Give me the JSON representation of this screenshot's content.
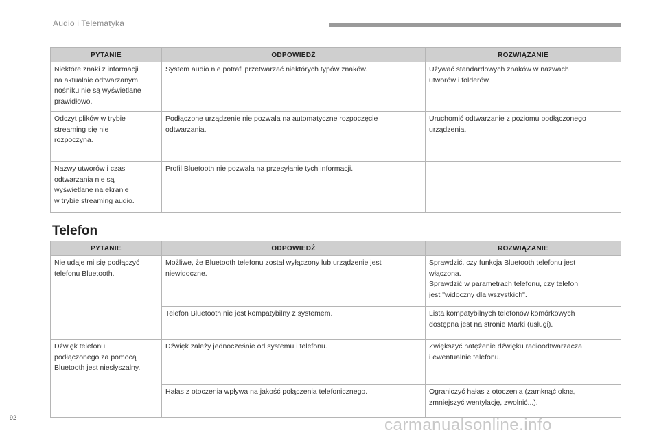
{
  "header": {
    "title": "Audio i Telematyka"
  },
  "table_audio": {
    "headers": [
      "PYTANIE",
      "ODPOWIEDŹ",
      "ROZWIĄZANIE"
    ],
    "rows": [
      {
        "question": "Niektóre znaki z informacji\nna aktualnie odtwarzanym\nnośniku nie są wyświetlane\nprawidłowo.",
        "answer": "System audio nie potrafi przetwarzać niektórych typów znaków.",
        "solution": "Używać standardowych znaków w nazwach\nutworów i folderów."
      },
      {
        "question": "Odczyt plików w trybie\nstreaming się nie\nrozpoczyna.",
        "answer": "Podłączone urządzenie nie pozwala na automatyczne rozpoczęcie\nodtwarzania.",
        "solution": "Uruchomić odtwarzanie z poziomu podłączonego\nurządzenia."
      },
      {
        "question": "Nazwy utworów i czas\nodtwarzania nie są\nwyświetlane na ekranie\nw trybie streaming audio.",
        "answer": "Profil Bluetooth nie pozwala na przesyłanie tych informacji.",
        "solution": ""
      }
    ]
  },
  "section_title": "Telefon",
  "table_phone": {
    "headers": [
      "PYTANIE",
      "ODPOWIEDŹ",
      "ROZWIĄZANIE"
    ],
    "groups": [
      {
        "question": "Nie udaje mi się podłączyć\ntelefonu Bluetooth.",
        "items": [
          {
            "answer": "Możliwe, że Bluetooth telefonu został wyłączony lub urządzenie jest\nniewidoczne.",
            "solution": "Sprawdzić, czy funkcja Bluetooth telefonu jest\nwłączona.\nSprawdzić w parametrach telefonu, czy telefon\njest \"widoczny dla wszystkich\"."
          },
          {
            "answer": "Telefon Bluetooth nie jest kompatybilny z systemem.",
            "solution": "Lista kompatybilnych telefonów komórkowych\ndostępna jest na stronie Marki (usługi)."
          }
        ]
      },
      {
        "question": "Dźwięk telefonu\npodłączonego za pomocą\nBluetooth jest niesłyszalny.",
        "items": [
          {
            "answer": "Dźwięk zależy jednocześnie od systemu i telefonu.",
            "solution": "Zwiększyć natężenie dźwięku radioodtwarzacza\ni ewentualnie telefonu."
          },
          {
            "answer": "Hałas z otoczenia wpływa na jakość połączenia telefonicznego.",
            "solution": "Ograniczyć hałas z otoczenia (zamknąć okna,\nzmniejszyć wentylację, zwolnić...)."
          }
        ]
      }
    ]
  },
  "page_number": "92",
  "watermark": "carmanualsonline.info"
}
